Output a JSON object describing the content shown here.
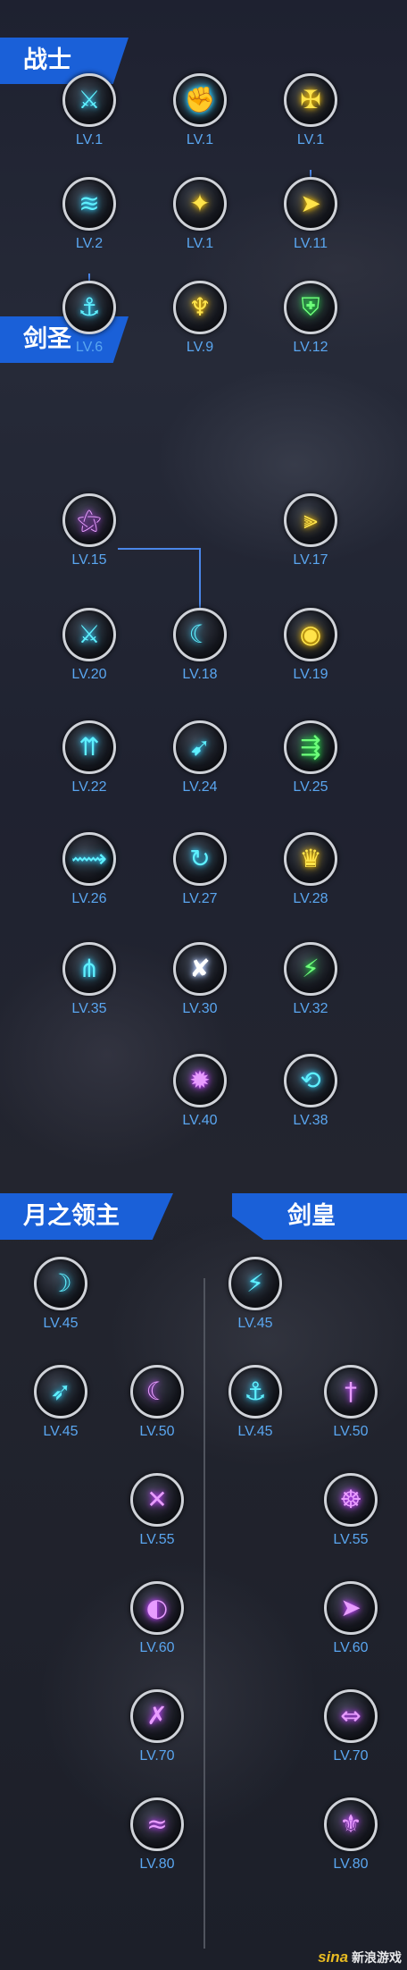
{
  "sections": {
    "warrior": "战士",
    "sword_saint": "剑圣",
    "moon_lord": "月之领主",
    "sword_emperor": "剑皇"
  },
  "skills": [
    {
      "id": "w1",
      "level": "LV.1",
      "color": "blue",
      "icon": "sword-slash-icon",
      "glyph": "⚔"
    },
    {
      "id": "w2",
      "level": "LV.1",
      "color": "blue",
      "icon": "spin-fist-icon",
      "glyph": "✊"
    },
    {
      "id": "w3",
      "level": "LV.1",
      "color": "yellow",
      "icon": "shield-cross-icon",
      "glyph": "✠"
    },
    {
      "id": "w4",
      "level": "LV.2",
      "color": "blue",
      "icon": "wave-strike-icon",
      "glyph": "≋"
    },
    {
      "id": "w5",
      "level": "LV.1",
      "color": "yellow",
      "icon": "power-up-icon",
      "glyph": "✦"
    },
    {
      "id": "w6",
      "level": "LV.11",
      "color": "yellow",
      "icon": "dash-kick-icon",
      "glyph": "➤"
    },
    {
      "id": "w7",
      "level": "LV.6",
      "color": "blue",
      "icon": "ground-slam-icon",
      "glyph": "⚓"
    },
    {
      "id": "w8",
      "level": "LV.9",
      "color": "yellow",
      "icon": "taunt-icon",
      "glyph": "♆"
    },
    {
      "id": "w9",
      "level": "LV.12",
      "color": "green",
      "icon": "guard-shield-icon",
      "glyph": "⛨"
    },
    {
      "id": "s1",
      "level": "LV.15",
      "color": "purple",
      "icon": "sword-rain-icon",
      "glyph": "⚝"
    },
    {
      "id": "s2",
      "level": "LV.17",
      "color": "yellow",
      "icon": "triple-blade-icon",
      "glyph": "⫸"
    },
    {
      "id": "s3",
      "level": "LV.20",
      "color": "blue",
      "icon": "combo-x3-icon",
      "glyph": "⚔"
    },
    {
      "id": "s4",
      "level": "LV.18",
      "color": "blue",
      "icon": "crescent-slash-icon",
      "glyph": "☾"
    },
    {
      "id": "s5",
      "level": "LV.19",
      "color": "yellow",
      "icon": "golden-aura-icon",
      "glyph": "◉"
    },
    {
      "id": "s6",
      "level": "LV.22",
      "color": "blue",
      "icon": "blade-storm-icon",
      "glyph": "⇈"
    },
    {
      "id": "s7",
      "level": "LV.24",
      "color": "blue",
      "icon": "piercing-strike-icon",
      "glyph": "➹"
    },
    {
      "id": "s8",
      "level": "LV.25",
      "color": "green",
      "icon": "multi-arrow-icon",
      "glyph": "⇶"
    },
    {
      "id": "s9",
      "level": "LV.26",
      "color": "blue",
      "icon": "sprint-slash-icon",
      "glyph": "⟿"
    },
    {
      "id": "s10",
      "level": "LV.27",
      "color": "blue",
      "icon": "whirlwind-icon",
      "glyph": "↻"
    },
    {
      "id": "s11",
      "level": "LV.28",
      "color": "yellow",
      "icon": "crown-icon",
      "glyph": "♛"
    },
    {
      "id": "s12",
      "level": "LV.35",
      "color": "blue",
      "icon": "trident-icon",
      "glyph": "⋔"
    },
    {
      "id": "s13",
      "level": "LV.30",
      "color": "white",
      "icon": "cross-slash-icon",
      "glyph": "✘"
    },
    {
      "id": "s14",
      "level": "LV.32",
      "color": "green",
      "icon": "lightning-peak-icon",
      "glyph": "⚡"
    },
    {
      "id": "s15",
      "level": "LV.40",
      "color": "purple",
      "icon": "flame-burst-icon",
      "glyph": "✹"
    },
    {
      "id": "s16",
      "level": "LV.38",
      "color": "blue",
      "icon": "parry-icon",
      "glyph": "⟲"
    },
    {
      "id": "m1",
      "level": "LV.45",
      "color": "blue",
      "icon": "moon-blade-icon",
      "glyph": "☽"
    },
    {
      "id": "m2",
      "level": "LV.45",
      "color": "blue",
      "icon": "moon-leap-icon",
      "glyph": "➶"
    },
    {
      "id": "m3",
      "level": "LV.50",
      "color": "purple",
      "icon": "moon-ex-icon",
      "glyph": "☾"
    },
    {
      "id": "m4",
      "level": "LV.55",
      "color": "purple",
      "icon": "moon-cross-ex-icon",
      "glyph": "✕"
    },
    {
      "id": "m5",
      "level": "LV.60",
      "color": "purple",
      "icon": "moon-orb-ex-icon",
      "glyph": "◐"
    },
    {
      "id": "m6",
      "level": "LV.70",
      "color": "purple",
      "icon": "moon-slash-ex-icon",
      "glyph": "✗"
    },
    {
      "id": "m7",
      "level": "LV.80",
      "color": "purple",
      "icon": "moon-wave-ex-icon",
      "glyph": "≈"
    },
    {
      "id": "e1",
      "level": "LV.45",
      "color": "blue",
      "icon": "emperor-strike-icon",
      "glyph": "⚡"
    },
    {
      "id": "e2",
      "level": "LV.45",
      "color": "blue",
      "icon": "emperor-anchor-icon",
      "glyph": "⚓"
    },
    {
      "id": "e3",
      "level": "LV.50",
      "color": "purple",
      "icon": "emperor-sword-ex-icon",
      "glyph": "†"
    },
    {
      "id": "e4",
      "level": "LV.55",
      "color": "purple",
      "icon": "emperor-totem-ex-icon",
      "glyph": "☸"
    },
    {
      "id": "e5",
      "level": "LV.60",
      "color": "purple",
      "icon": "emperor-dash-ex-icon",
      "glyph": "➤"
    },
    {
      "id": "e6",
      "level": "LV.70",
      "color": "purple",
      "icon": "emperor-blades-ex-icon",
      "glyph": "⇔"
    },
    {
      "id": "e7",
      "level": "LV.80",
      "color": "purple",
      "icon": "emperor-rune-ex-icon",
      "glyph": "⚜"
    }
  ],
  "watermark": {
    "mark": "sina",
    "text": "新浪游戏"
  }
}
